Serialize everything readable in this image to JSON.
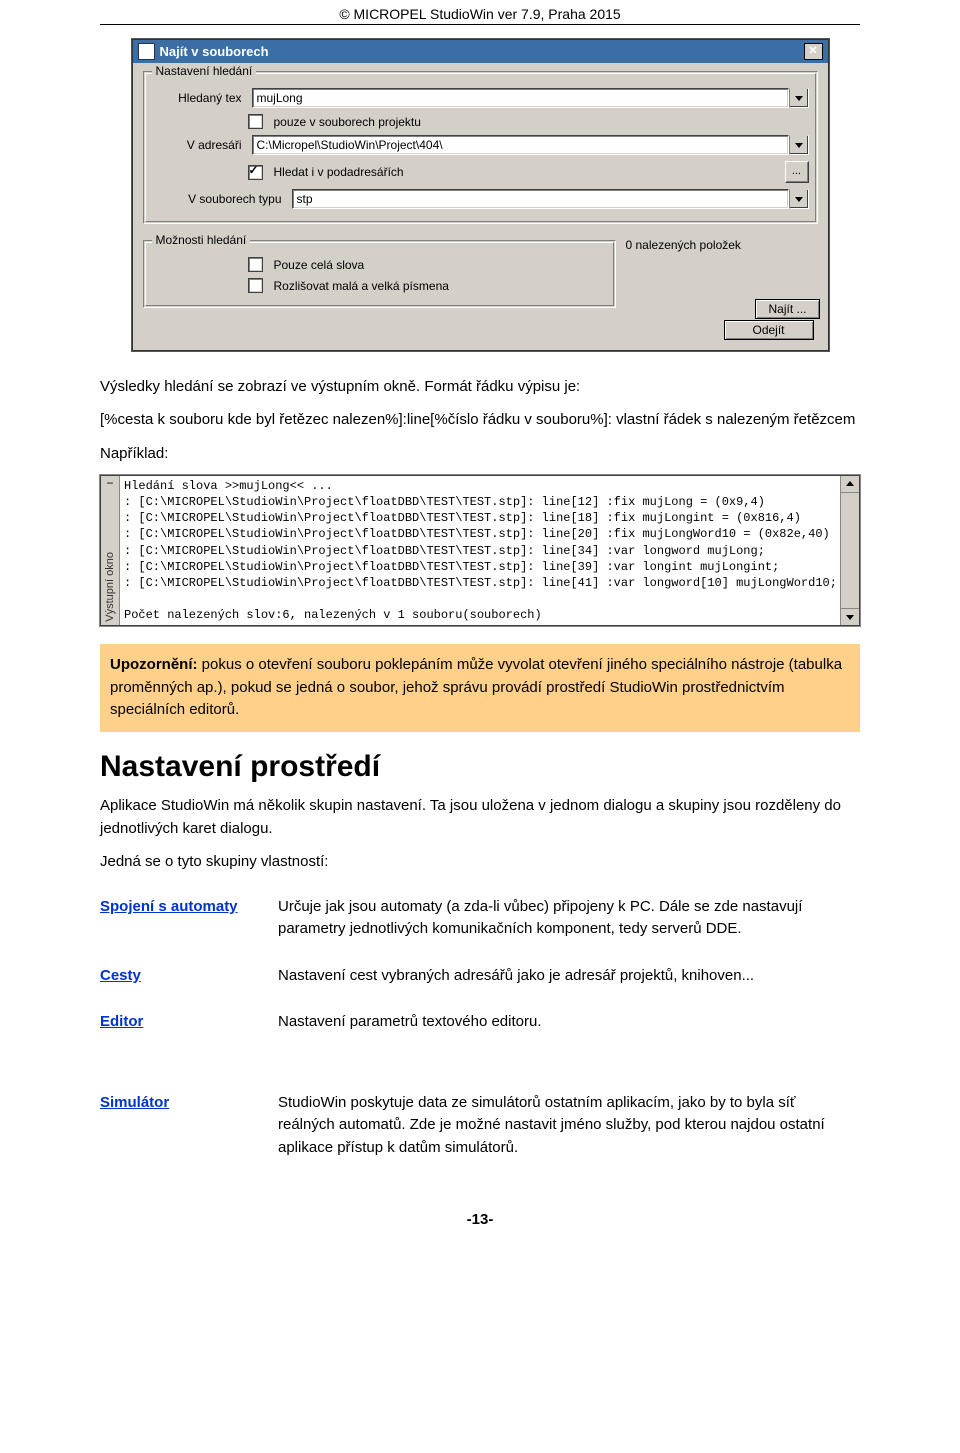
{
  "header": "© MICROPEL StudioWin ver 7.9,  Praha 2015",
  "dialog": {
    "title": "Najít v souborech",
    "group_search": "Nastavení hledání",
    "row_text_lbl": "Hledaný tex",
    "row_text_val": "mujLong",
    "chk_project_only": "pouze v souborech projektu",
    "row_dir_lbl": "V adresáři",
    "row_dir_val": "C:\\Micropel\\StudioWin\\Project\\404\\",
    "chk_subdirs": "Hledat i v podadresářích",
    "row_type_lbl": "V souborech typu",
    "row_type_val": "stp",
    "group_opts": "Možnosti hledání",
    "chk_whole": "Pouze celá slova",
    "chk_case": "Rozlišovat malá a velká písmena",
    "found_text": "0 nalezených položek",
    "btn_find": "Najít ...",
    "btn_close": "Odejít"
  },
  "body": {
    "p1": "Výsledky hledání se zobrazí ve výstupním okně. Formát řádku výpisu je:",
    "p2": "[%cesta k souboru kde byl řetězec nalezen%]:line[%číslo řádku v souboru%]: vlastní řádek s nalezeným řetězcem",
    "p3": "Například:",
    "output_side_label": "Výstupní okno",
    "output_lines": [
      "Hledání slova >>mujLong<< ...",
      ": [C:\\MICROPEL\\StudioWin\\Project\\floatDBD\\TEST\\TEST.stp]: line[12] :fix mujLong = (0x9,4)",
      ": [C:\\MICROPEL\\StudioWin\\Project\\floatDBD\\TEST\\TEST.stp]: line[18] :fix mujLongint = (0x816,4)",
      ": [C:\\MICROPEL\\StudioWin\\Project\\floatDBD\\TEST\\TEST.stp]: line[20] :fix mujLongWord10 = (0x82e,40)",
      ": [C:\\MICROPEL\\StudioWin\\Project\\floatDBD\\TEST\\TEST.stp]: line[34] :var longword mujLong;",
      ": [C:\\MICROPEL\\StudioWin\\Project\\floatDBD\\TEST\\TEST.stp]: line[39] :var longint mujLongint;",
      ": [C:\\MICROPEL\\StudioWin\\Project\\floatDBD\\TEST\\TEST.stp]: line[41] :var longword[10] mujLongWord10;",
      "",
      "Počet nalezených slov:6, nalezených v 1 souboru(souborech)"
    ],
    "callout_strong": "Upozornění:",
    "callout_rest": " pokus o otevření souboru poklepáním může vyvolat otevření jiného speciálního nástroje (tabulka proměnných ap.), pokud se jedná o soubor, jehož správu provádí prostředí StudioWin prostřednictvím speciálních editorů.",
    "h1": "Nastavení prostředí",
    "p4": "Aplikace StudioWin má několik skupin nastavení. Ta jsou uložena v jednom dialogu a skupiny jsou rozděleny do jednotlivých karet dialogu.",
    "p5": "Jedná se o tyto skupiny vlastností:"
  },
  "props": [
    {
      "name": "Spojení s automaty",
      "desc": "Určuje jak jsou automaty (a zda-li vůbec) připojeny k PC. Dále se zde nastavují parametry jednotlivých komunikačních komponent, tedy serverů DDE."
    },
    {
      "name": "Cesty",
      "desc": "Nastavení cest vybraných adresářů jako je adresář projektů, knihoven..."
    },
    {
      "name": "Editor",
      "desc": "Nastavení parametrů textového editoru."
    },
    {
      "name": "Simulátor",
      "desc": "StudioWin poskytuje data ze simulátorů ostatním aplikacím, jako by to byla síť reálných automatů. Zde je možné nastavit jméno služby, pod kterou najdou ostatní aplikace přístup k datům simulátorů."
    }
  ],
  "pagenum": "-13-"
}
